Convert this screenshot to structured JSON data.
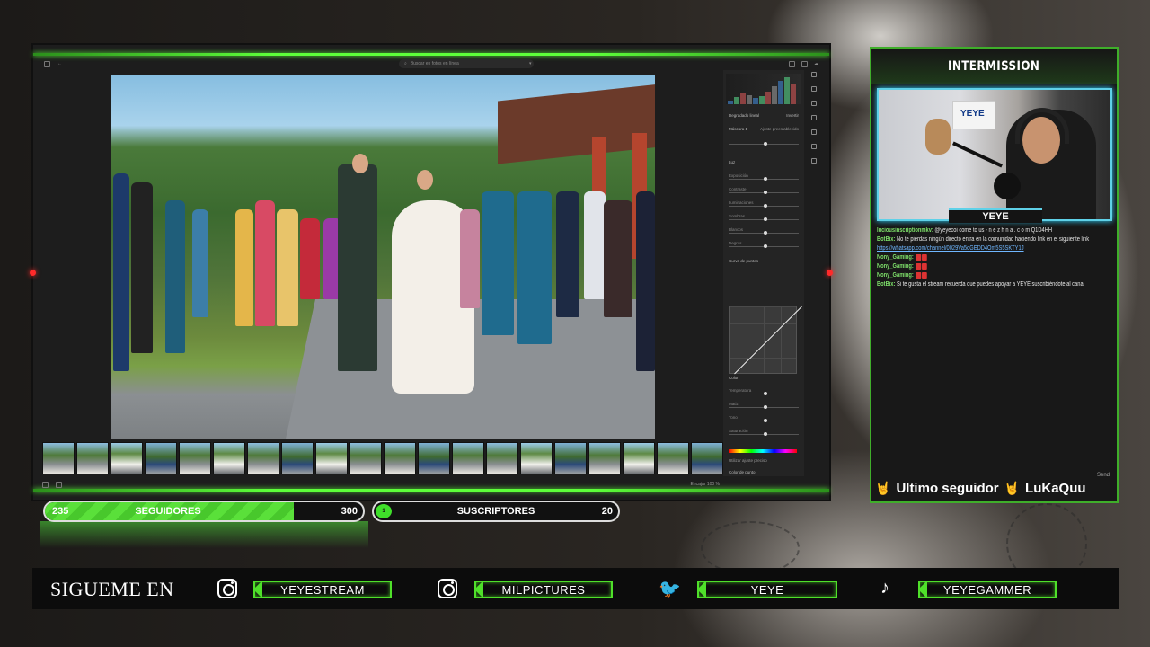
{
  "editor": {
    "search_placeholder": "Buscar en fotos en línea",
    "panel": {
      "tool_title": "Degradado lineal",
      "invert_label": "Invertir",
      "mask_label": "Máscara 1",
      "preset_label": "Ajuste preestablecido",
      "sections": [
        "Luz",
        "Curva de puntos",
        "Color",
        "Color de punto"
      ],
      "luz_sliders": [
        "Exposición",
        "Contraste",
        "Iluminaciones",
        "Sombras",
        "Blancos",
        "Negros"
      ],
      "color_sliders": [
        "Temperatura",
        "Matiz",
        "Tono",
        "Saturación"
      ],
      "point_color_label": "Utilizar ajuste preciso"
    },
    "status": {
      "zoom_label": "Encajar",
      "zoom_value": "100 %"
    }
  },
  "stream": {
    "title": "INTERMISSION",
    "streamer_name": "YEYE",
    "poster_text": "YEYE",
    "chat": [
      {
        "user": "luciousinscriptionmkv:",
        "text": "@yeyecoi come to us - n e z h n a . c o m Q1D4HH"
      },
      {
        "user": "BotBix:",
        "text": "No te pierdas ningún directo entra en la comunidad haciendo link en el siguiente link"
      },
      {
        "user": "",
        "text": "https://whatsapp.com/channel/0029Va5dGEDD4Om5S5SKTY1J",
        "link": true
      },
      {
        "user": "Nony_Gaming:",
        "text": ""
      },
      {
        "user": "Nony_Gaming:",
        "text": ""
      },
      {
        "user": "Nony_Gaming:",
        "text": ""
      },
      {
        "user": "BotBix:",
        "text": "Si te gusta el stream recuerda que puedes apoyar a YEYE suscribiéndote al canal"
      }
    ],
    "last_follower_label": "Ultimo seguidor",
    "last_follower_name": "LuKaQuu",
    "send_label": "Send"
  },
  "goals": {
    "followers": {
      "current": "235",
      "label": "SEGUIDORES",
      "target": "300",
      "progress": 0.783
    },
    "subs": {
      "current": "1",
      "label": "SUSCRIPTORES",
      "target": "20",
      "progress": 0.05
    }
  },
  "social": {
    "title": "SIGUEME EN",
    "accounts": [
      {
        "platform": "instagram-icon",
        "handle": "YEYESTREAM"
      },
      {
        "platform": "instagram-icon",
        "handle": "MILPICTURES"
      },
      {
        "platform": "twitter-icon",
        "handle": "YEYE"
      },
      {
        "platform": "tiktok-icon",
        "handle": "YEYEGAMMER"
      }
    ]
  },
  "colors": {
    "accent_green": "#4fe02a",
    "cam_border": "#5fd1e8",
    "chat_user": "#7ee06a"
  }
}
